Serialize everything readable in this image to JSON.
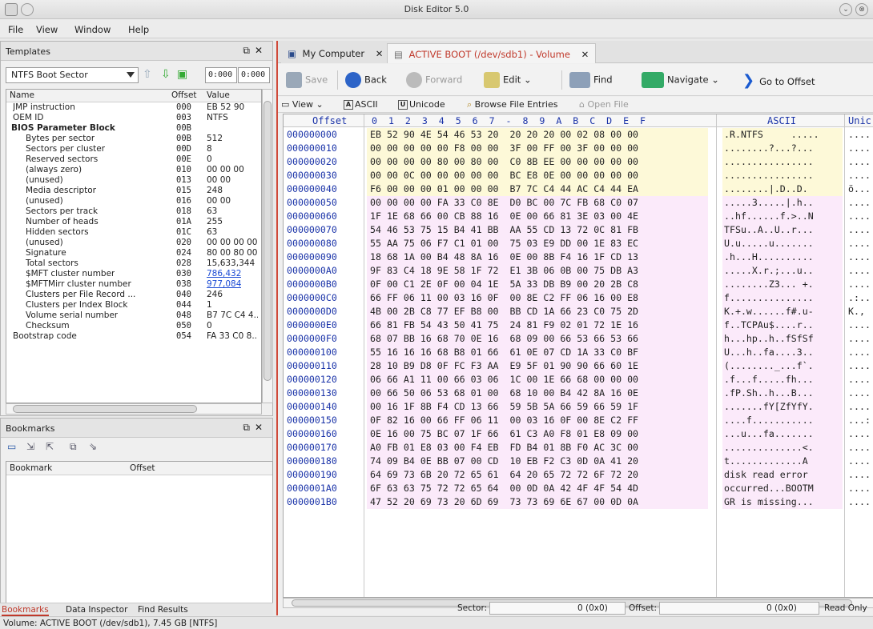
{
  "window": {
    "title": "Disk Editor 5.0"
  },
  "menu": [
    "File",
    "View",
    "Window",
    "Help"
  ],
  "templates": {
    "panel_title": "Templates",
    "selected_template": "NTFS Boot Sector",
    "range_start": "0:000",
    "range_end": "0:000",
    "columns": [
      "Name",
      "Offset",
      "Value"
    ],
    "rows": [
      {
        "name": "JMP instruction",
        "offset": "000",
        "value": "EB 52 90",
        "level": 1
      },
      {
        "name": "OEM ID",
        "offset": "003",
        "value": "NTFS",
        "level": 1
      },
      {
        "name": "BIOS Parameter Block",
        "offset": "00B",
        "value": "",
        "level": 0,
        "bold": true
      },
      {
        "name": "Bytes per sector",
        "offset": "00B",
        "value": "512",
        "level": 2
      },
      {
        "name": "Sectors per cluster",
        "offset": "00D",
        "value": "8",
        "level": 2
      },
      {
        "name": "Reserved sectors",
        "offset": "00E",
        "value": "0",
        "level": 2
      },
      {
        "name": "(always zero)",
        "offset": "010",
        "value": "00 00 00",
        "level": 2
      },
      {
        "name": "(unused)",
        "offset": "013",
        "value": "00 00",
        "level": 2
      },
      {
        "name": "Media descriptor",
        "offset": "015",
        "value": "248",
        "level": 2
      },
      {
        "name": "(unused)",
        "offset": "016",
        "value": "00 00",
        "level": 2
      },
      {
        "name": "Sectors per track",
        "offset": "018",
        "value": "63",
        "level": 2
      },
      {
        "name": "Number of heads",
        "offset": "01A",
        "value": "255",
        "level": 2
      },
      {
        "name": "Hidden sectors",
        "offset": "01C",
        "value": "63",
        "level": 2
      },
      {
        "name": "(unused)",
        "offset": "020",
        "value": "00 00 00 00",
        "level": 2
      },
      {
        "name": "Signature",
        "offset": "024",
        "value": "80 00 80 00",
        "level": 2
      },
      {
        "name": "Total sectors",
        "offset": "028",
        "value": "15,633,344",
        "level": 2
      },
      {
        "name": "$MFT cluster number",
        "offset": "030",
        "value": "786,432",
        "level": 2,
        "link": true
      },
      {
        "name": "$MFTMirr cluster number",
        "offset": "038",
        "value": "977,084",
        "level": 2,
        "link": true
      },
      {
        "name": "Clusters per File Record ...",
        "offset": "040",
        "value": "246",
        "level": 2
      },
      {
        "name": "Clusters per Index Block",
        "offset": "044",
        "value": "1",
        "level": 2
      },
      {
        "name": "Volume serial number",
        "offset": "048",
        "value": "B7 7C C4 4...",
        "level": 2
      },
      {
        "name": "Checksum",
        "offset": "050",
        "value": "0",
        "level": 2
      },
      {
        "name": "Bootstrap code",
        "offset": "054",
        "value": "FA 33 C0 8...",
        "level": 1
      }
    ]
  },
  "bookmarks": {
    "panel_title": "Bookmarks",
    "columns": [
      "Bookmark",
      "Offset"
    ]
  },
  "left_tabs": [
    "Bookmarks",
    "Data Inspector",
    "Find Results"
  ],
  "status": "Volume: ACTIVE BOOT (/dev/sdb1), 7.45 GB [NTFS]",
  "doc_tabs": [
    {
      "label": "My Computer",
      "active": false
    },
    {
      "label": "ACTIVE BOOT (/dev/sdb1) - Volume",
      "active": true
    }
  ],
  "toolbar": {
    "save": "Save",
    "back": "Back",
    "forward": "Forward",
    "edit": "Edit",
    "find": "Find",
    "navigate": "Navigate",
    "goto": "Go to Offset"
  },
  "toolbar2": {
    "view": "View",
    "ascii": "ASCII",
    "unicode": "Unicode",
    "browse": "Browse File Entries",
    "open": "Open File"
  },
  "hex": {
    "header_offset": "Offset",
    "header_cols": [
      "0",
      "1",
      "2",
      "3",
      "4",
      "5",
      "6",
      "7",
      "-",
      "8",
      "9",
      "A",
      "B",
      "C",
      "D",
      "E",
      "F"
    ],
    "header_ascii": "ASCII",
    "header_unicode": "Unic",
    "rows": [
      {
        "off": "000000000",
        "bytes": "EB 52 90 4E 54 46 53 20  20 20 20 00 02 08 00 00",
        "ascii": ".R.NTFS     .....",
        "uni": "...."
      },
      {
        "off": "000000010",
        "bytes": "00 00 00 00 00 F8 00 00  3F 00 FF 00 3F 00 00 00",
        "ascii": "........?...?...",
        "uni": "...."
      },
      {
        "off": "000000020",
        "bytes": "00 00 00 00 80 00 80 00  C0 8B EE 00 00 00 00 00",
        "ascii": "................",
        "uni": "...."
      },
      {
        "off": "000000030",
        "bytes": "00 00 0C 00 00 00 00 00  BC E8 0E 00 00 00 00 00",
        "ascii": "................",
        "uni": "...."
      },
      {
        "off": "000000040",
        "bytes": "F6 00 00 00 01 00 00 00  B7 7C C4 44 AC C4 44 EA",
        "ascii": "........|.D..D.",
        "uni": "ö..."
      },
      {
        "off": "000000050",
        "bytes": "00 00 00 00 FA 33 C0 8E  D0 BC 00 7C FB 68 C0 07",
        "ascii": ".....3.....|.h..",
        "uni": "...."
      },
      {
        "off": "000000060",
        "bytes": "1F 1E 68 66 00 CB 88 16  0E 00 66 81 3E 03 00 4E",
        "ascii": "..hf......f.>..N",
        "uni": "...."
      },
      {
        "off": "000000070",
        "bytes": "54 46 53 75 15 B4 41 BB  AA 55 CD 13 72 0C 81 FB",
        "ascii": "TFSu..A..U..r...",
        "uni": "...."
      },
      {
        "off": "000000080",
        "bytes": "55 AA 75 06 F7 C1 01 00  75 03 E9 DD 00 1E 83 EC",
        "ascii": "U.u.....u.......",
        "uni": "...."
      },
      {
        "off": "000000090",
        "bytes": "18 68 1A 00 B4 48 8A 16  0E 00 8B F4 16 1F CD 13",
        "ascii": ".h...H..........",
        "uni": "...."
      },
      {
        "off": "0000000A0",
        "bytes": "9F 83 C4 18 9E 58 1F 72  E1 3B 06 0B 00 75 DB A3",
        "ascii": ".....X.r.;...u..",
        "uni": "...."
      },
      {
        "off": "0000000B0",
        "bytes": "0F 00 C1 2E 0F 00 04 1E  5A 33 DB B9 00 20 2B C8",
        "ascii": "........Z3... +.",
        "uni": "...."
      },
      {
        "off": "0000000C0",
        "bytes": "66 FF 06 11 00 03 16 0F  00 8E C2 FF 06 16 00 E8",
        "ascii": "f...............",
        "uni": ".:.."
      },
      {
        "off": "0000000D0",
        "bytes": "4B 00 2B C8 77 EF B8 00  BB CD 1A 66 23 C0 75 2D",
        "ascii": "K.+.w......f#.u-",
        "uni": "K.,"
      },
      {
        "off": "0000000E0",
        "bytes": "66 81 FB 54 43 50 41 75  24 81 F9 02 01 72 1E 16",
        "ascii": "f..TCPAu$....r..",
        "uni": "...."
      },
      {
        "off": "0000000F0",
        "bytes": "68 07 BB 16 68 70 0E 16  68 09 00 66 53 66 53 66",
        "ascii": "h...hp..h..fSfSf",
        "uni": "...."
      },
      {
        "off": "000000100",
        "bytes": "55 16 16 16 68 B8 01 66  61 0E 07 CD 1A 33 C0 BF",
        "ascii": "U...h..fa....3..",
        "uni": "...."
      },
      {
        "off": "000000110",
        "bytes": "28 10 B9 D8 0F FC F3 AA  E9 5F 01 90 90 66 60 1E",
        "ascii": "(........_...f`.",
        "uni": "...."
      },
      {
        "off": "000000120",
        "bytes": "06 66 A1 11 00 66 03 06  1C 00 1E 66 68 00 00 00",
        "ascii": ".f...f.....fh...",
        "uni": "...."
      },
      {
        "off": "000000130",
        "bytes": "00 66 50 06 53 68 01 00  68 10 00 B4 42 8A 16 0E",
        "ascii": ".fP.Sh..h...B...",
        "uni": "...."
      },
      {
        "off": "000000140",
        "bytes": "00 16 1F 8B F4 CD 13 66  59 5B 5A 66 59 66 59 1F",
        "ascii": ".......fY[ZfYfY.",
        "uni": "...."
      },
      {
        "off": "000000150",
        "bytes": "0F 82 16 00 66 FF 06 11  00 03 16 0F 00 8E C2 FF",
        "ascii": "....f...........",
        "uni": "...:"
      },
      {
        "off": "000000160",
        "bytes": "0E 16 00 75 BC 07 1F 66  61 C3 A0 F8 01 E8 09 00",
        "ascii": "...u...fa.......",
        "uni": "...."
      },
      {
        "off": "000000170",
        "bytes": "A0 FB 01 E8 03 00 F4 EB  FD B4 01 8B F0 AC 3C 00",
        "ascii": "..............<.",
        "uni": "...."
      },
      {
        "off": "000000180",
        "bytes": "74 09 B4 0E BB 07 00 CD  10 EB F2 C3 0D 0A 41 20",
        "ascii": "t.............A ",
        "uni": "...."
      },
      {
        "off": "000000190",
        "bytes": "64 69 73 6B 20 72 65 61  64 20 65 72 72 6F 72 20",
        "ascii": "disk read error ",
        "uni": "...."
      },
      {
        "off": "0000001A0",
        "bytes": "6F 63 63 75 72 72 65 64  00 0D 0A 42 4F 4F 54 4D",
        "ascii": "occurred...BOOTM",
        "uni": "...."
      },
      {
        "off": "0000001B0",
        "bytes": "47 52 20 69 73 20 6D 69  73 73 69 6E 67 00 0D 0A",
        "ascii": "GR is missing...",
        "uni": "...."
      }
    ]
  },
  "sector_bar": {
    "sector_label": "Sector:",
    "sector_value": "0 (0x0)",
    "offset_label": "Offset:",
    "offset_value": "0 (0x0)",
    "mode": "Read Only"
  },
  "colors": {
    "accent": "#d04a3a",
    "offset_blue": "#1a33a8",
    "zone_yellow": "#fdf9d8",
    "zone_pink": "#fbeafa"
  }
}
